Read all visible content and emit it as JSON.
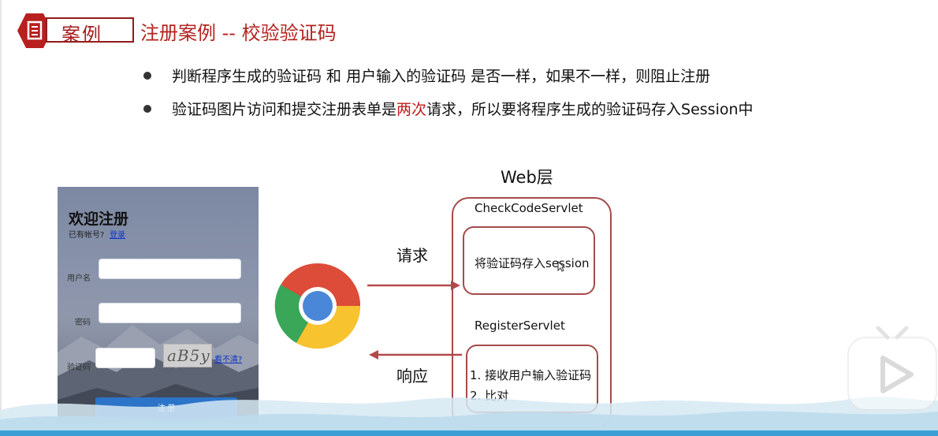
{
  "header": {
    "badge_label": "案例",
    "title": "注册案例 -- 校验验证码"
  },
  "bullets": [
    {
      "text": "判断程序生成的验证码 和 用户输入的验证码 是否一样，如果不一样，则阻止注册"
    },
    {
      "text_before": "验证码图片访问和提交注册表单是",
      "highlight": "两次",
      "text_after": "请求，所以要将程序生成的验证码存入Session中"
    }
  ],
  "register_form": {
    "title": "欢迎注册",
    "has_account": "已有帐号?",
    "login_link": "登录",
    "username_label": "用户名",
    "password_label": "密码",
    "code_label": "验证码",
    "captcha_text": "aB5y",
    "refresh_link": "看不清?换一张?",
    "submit_label": "注 册"
  },
  "diagram": {
    "web_layer_label": "Web层",
    "request_label": "请求",
    "response_label": "响应",
    "servlet1": "CheckCodeServlet",
    "servlet1_step": "将验证码存入session",
    "servlet2": "RegisterServlet",
    "servlet2_step1": "1. 接收用户输入验证码",
    "servlet2_step2": "2. 比对"
  },
  "colors": {
    "accent_red": "#b3241f",
    "box_border": "#a64a4a",
    "link_blue": "#1236c8",
    "button_blue": "#2b74c8"
  },
  "icons": {
    "badge": "document-icon",
    "browser": "chrome-icon",
    "overlay": "play-icon"
  }
}
